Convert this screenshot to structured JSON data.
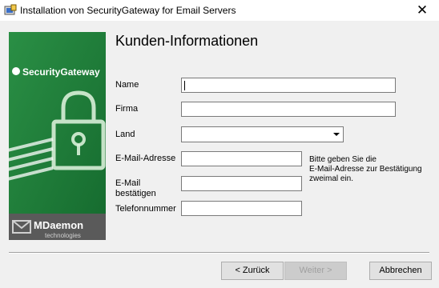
{
  "window": {
    "title": "Installation von SecurityGateway for Email Servers"
  },
  "sidebar": {
    "product_logo": "SecurityGateway",
    "vendor_logo": "MDaemon",
    "vendor_tagline": "technologies"
  },
  "page": {
    "heading": "Kunden-Informationen"
  },
  "form": {
    "name_label": "Name",
    "name_value": "",
    "company_label": "Firma",
    "company_value": "",
    "country_label": "Land",
    "country_selected": "",
    "email_label": "E-Mail-Adresse",
    "email_value": "",
    "email_confirm_label_line1": "E-Mail",
    "email_confirm_label_line2": "bestätigen",
    "email_confirm_value": "",
    "phone_label": "Telefonnummer",
    "phone_value": "",
    "hint_line1": "Bitte geben Sie die",
    "hint_line2": "E-Mail-Adresse zur Bestätigung",
    "hint_line3": "zweimal ein."
  },
  "buttons": {
    "back": "< Zurück",
    "next": "Weiter >",
    "cancel": "Abbrechen"
  },
  "icons": {
    "close": "close-icon",
    "app": "installer-icon",
    "lock": "padlock-icon",
    "envelope": "envelope-icon"
  },
  "colors": {
    "sidebar_green": "#1e7a3a",
    "sidebar_footer": "#5a5a5a"
  }
}
